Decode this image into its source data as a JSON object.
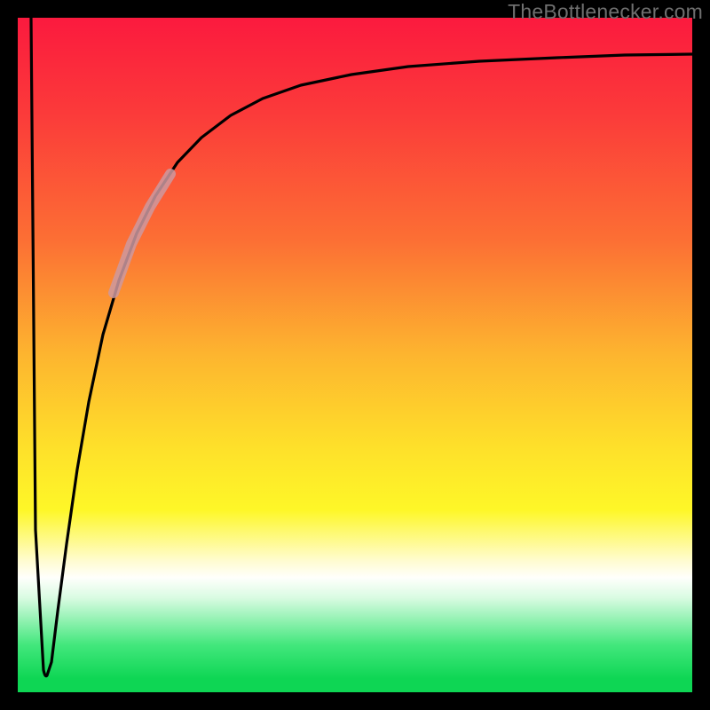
{
  "watermark": "TheBottlenecker.com",
  "chart_data": {
    "type": "line",
    "title": "",
    "xlabel": "",
    "ylabel": "",
    "xlim": [
      0,
      100
    ],
    "ylim": [
      0,
      100
    ],
    "x": [
      2.0,
      2.7,
      3.8,
      4.2,
      5.1,
      6.0,
      7.2,
      8.8,
      10.5,
      12.6,
      15.0,
      17.6,
      20.4,
      23.7,
      27.2,
      31.6,
      36.3,
      42.0,
      49.5,
      58.0,
      68.4,
      80.0,
      90.0,
      100.0
    ],
    "y": [
      100.0,
      24.0,
      3.2,
      2.5,
      4.5,
      12.0,
      22.0,
      33.0,
      43.0,
      53.0,
      61.0,
      68.0,
      73.5,
      78.5,
      82.2,
      85.5,
      88.0,
      90.0,
      91.6,
      92.7,
      93.5,
      94.1,
      94.4,
      94.6
    ],
    "highlight_range_x": [
      14.0,
      22.5
    ],
    "gradient_stops": [
      {
        "pos": 0.0,
        "color": "#fb1a3e"
      },
      {
        "pos": 0.33,
        "color": "#fc6f34"
      },
      {
        "pos": 0.64,
        "color": "#fee12a"
      },
      {
        "pos": 0.83,
        "color": "#fffffc"
      },
      {
        "pos": 0.98,
        "color": "#0ed654"
      }
    ]
  }
}
